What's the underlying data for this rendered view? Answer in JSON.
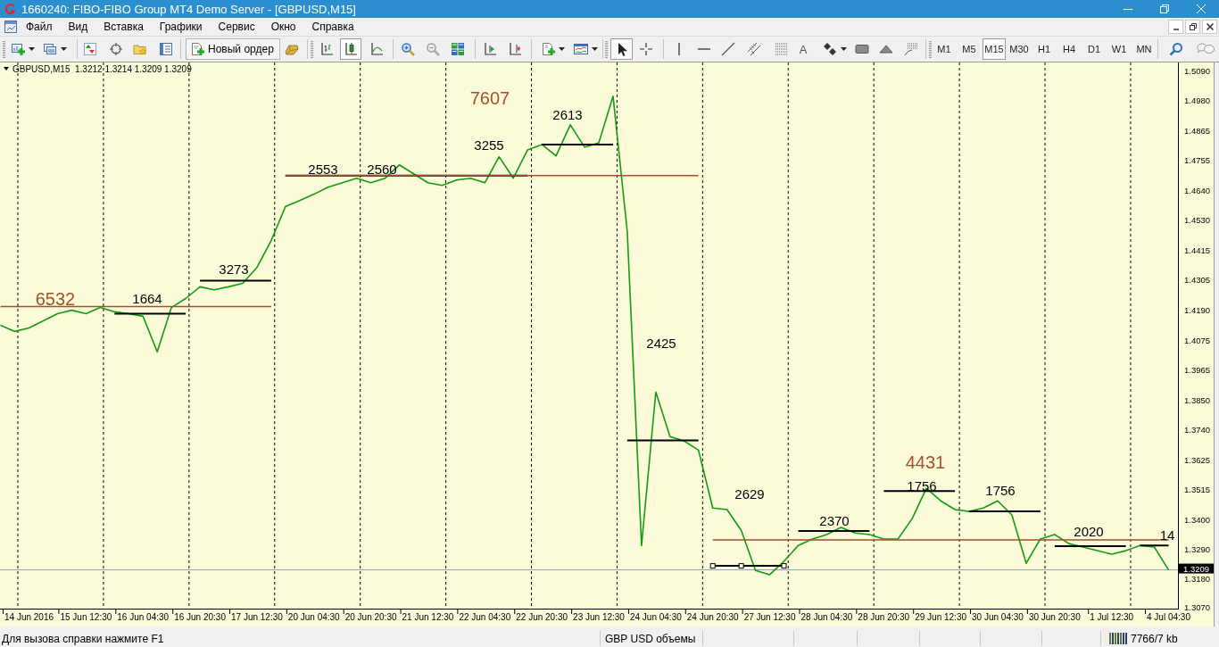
{
  "window": {
    "title": "1660240: FIBO-FIBO Group MT4 Demo Server - [GBPUSD,M15]"
  },
  "menu": [
    "Файл",
    "Вид",
    "Вставка",
    "Графики",
    "Сервис",
    "Окно",
    "Справка"
  ],
  "toolbar": {
    "new_order": "Новый ордер",
    "chart_types": [
      {
        "selected": false
      },
      {
        "selected": true
      },
      {
        "selected": false
      }
    ],
    "pointer_tools": [
      {
        "selected": true
      },
      {
        "selected": false
      }
    ],
    "text_tool": "A",
    "timeframes": [
      {
        "label": "M1",
        "selected": false
      },
      {
        "label": "M5",
        "selected": false
      },
      {
        "label": "M15",
        "selected": true
      },
      {
        "label": "M30",
        "selected": false
      },
      {
        "label": "H1",
        "selected": false
      },
      {
        "label": "H4",
        "selected": false
      },
      {
        "label": "D1",
        "selected": false
      },
      {
        "label": "W1",
        "selected": false
      },
      {
        "label": "MN",
        "selected": false
      }
    ]
  },
  "chart": {
    "chart_data": {
      "type": "line",
      "title": "GBPUSD,M15  1.3212 1.3214 1.3209 1.3209",
      "categories": [
        null,
        null,
        "14 Jun 2016",
        null,
        null,
        null,
        "15 Jun 12:30",
        null,
        null,
        null,
        "16 Jun 04:30",
        null,
        null,
        null,
        "16 Jun 20:30",
        null,
        null,
        null,
        "17 Jun 12:30",
        null,
        null,
        null,
        "20 Jun 04:30",
        null,
        null,
        null,
        "20 Jun 20:30",
        null,
        null,
        null,
        "21 Jun 12:30",
        null,
        null,
        null,
        "22 Jun 04:30",
        null,
        null,
        null,
        "22 Jun 20:30",
        null,
        null,
        null,
        "23 Jun 12:30",
        null,
        null,
        null,
        "24 Jun 04:30",
        null,
        null,
        null,
        "24 Jun 20:30",
        null,
        null,
        null,
        "27 Jun 12:30",
        null,
        null,
        null,
        "28 Jun 04:30",
        null,
        null,
        null,
        "28 Jun 20:30",
        null,
        null,
        null,
        "29 Jun 12:30",
        null,
        null,
        null,
        "30 Jun 04:30",
        null,
        null,
        null,
        "30 Jun 20:30",
        null,
        null,
        null,
        "1 Jul 12:30",
        null,
        null,
        null,
        "4 Jul 04:30"
      ],
      "series": [
        {
          "color": "#139a13",
          "values": [
            1.413,
            1.4107,
            1.412,
            1.4147,
            1.4174,
            1.4187,
            1.4174,
            1.4197,
            1.4181,
            1.4174,
            1.4164,
            1.403,
            1.4197,
            1.4231,
            1.4275,
            1.4264,
            1.4275,
            1.4288,
            1.4348,
            1.4449,
            1.4577,
            1.46,
            1.4624,
            1.465,
            1.4667,
            1.4684,
            1.4667,
            1.4684,
            1.4734,
            1.4701,
            1.4667,
            1.4657,
            1.4677,
            1.4684,
            1.4667,
            1.4765,
            1.4684,
            1.4791,
            1.4811,
            1.4768,
            1.4885,
            1.4801,
            1.4818,
            1.4993,
            1.4483,
            1.33,
            1.3879,
            1.3711,
            1.3694,
            1.366,
            1.3442,
            1.3436,
            1.3358,
            1.3207,
            1.3191,
            1.3241,
            1.3301,
            1.3325,
            1.3342,
            1.3369,
            1.3348,
            1.3342,
            1.3325,
            1.3325,
            1.3402,
            1.3516,
            1.3469,
            1.3436,
            1.3429,
            1.3442,
            1.3469,
            1.3416,
            1.3234,
            1.3325,
            1.3342,
            1.3308,
            1.3295,
            1.3281,
            1.3268,
            1.3281,
            1.3301,
            1.3295,
            1.3209
          ]
        },
        {
          "color": "#000000",
          "values": [
            null,
            null,
            null,
            null,
            null,
            null,
            null,
            null,
            1.4174,
            1.4174,
            1.4174,
            1.4174,
            1.4174,
            1.4174,
            1.4298,
            1.4298,
            1.4298,
            1.4298,
            1.4298,
            1.4298,
            1.4694,
            1.4694,
            1.4694,
            1.4694,
            1.4694,
            1.4694,
            1.4694,
            1.4694,
            1.4694,
            1.4694,
            1.4694,
            1.4694,
            1.4694,
            1.4694,
            1.4694,
            1.4694,
            1.4694,
            1.4694,
            1.4811,
            1.4811,
            1.4811,
            1.4811,
            1.4811,
            1.4811,
            1.3697,
            1.3697,
            1.3697,
            1.3697,
            1.3697,
            1.3697,
            null,
            null,
            null,
            null,
            null,
            null,
            1.3355,
            1.3355,
            1.3355,
            1.3355,
            1.3355,
            1.3355,
            1.3506,
            1.3506,
            1.3506,
            1.3506,
            1.3506,
            1.3506,
            1.3429,
            1.3429,
            1.3429,
            1.3429,
            1.3429,
            1.3429,
            1.3298,
            1.3298,
            1.3298,
            1.3298,
            1.3298,
            1.3298,
            1.3301,
            1.3301,
            1.3301
          ]
        },
        {
          "color": "#a0522d",
          "values": [
            1.4201,
            1.4201,
            1.4201,
            1.4201,
            1.4201,
            1.4201,
            1.4201,
            1.4201,
            1.4201,
            1.4201,
            1.4201,
            1.4201,
            1.4201,
            1.4201,
            1.4201,
            1.4201,
            1.4201,
            1.4201,
            1.4201,
            1.4201,
            1.4694,
            1.4694,
            1.4694,
            1.4694,
            1.4694,
            1.4694,
            1.4694,
            1.4694,
            1.4694,
            1.4694,
            1.4694,
            1.4694,
            1.4694,
            1.4694,
            1.4694,
            1.4694,
            1.4694,
            1.4694,
            1.4694,
            1.4694,
            1.4694,
            1.4694,
            1.4694,
            1.4694,
            1.4694,
            1.4694,
            1.4694,
            1.4694,
            1.4694,
            1.4694,
            1.3322,
            1.3322,
            1.3322,
            1.3322,
            1.3322,
            1.3322,
            1.3322,
            1.3322,
            1.3322,
            1.3322,
            1.3322,
            1.3322,
            1.3322,
            1.3322,
            1.3322,
            1.3322,
            1.3322,
            1.3322,
            1.3322,
            1.3322,
            1.3322,
            1.3322,
            1.3322,
            1.3322,
            1.3322,
            1.3322,
            1.3322,
            1.3322,
            1.3322,
            1.3322,
            1.3322,
            1.3322,
            1.3322
          ]
        },
        {
          "color": "#000000",
          "values": [
            null,
            null,
            null,
            null,
            null,
            null,
            null,
            null,
            null,
            null,
            null,
            null,
            null,
            null,
            null,
            null,
            null,
            null,
            null,
            null,
            null,
            null,
            null,
            null,
            null,
            null,
            null,
            null,
            null,
            null,
            null,
            null,
            null,
            null,
            null,
            null,
            null,
            null,
            null,
            null,
            null,
            null,
            null,
            null,
            null,
            null,
            null,
            null,
            null,
            null,
            1.3224,
            1.3224,
            1.3224,
            1.3224,
            1.3224,
            1.3224,
            null,
            null,
            null,
            null,
            null,
            null,
            null,
            null,
            null,
            null,
            null,
            null,
            null,
            null,
            null,
            null,
            null,
            null,
            null,
            null,
            null,
            null,
            null,
            null,
            null,
            null,
            null
          ]
        }
      ],
      "ylim": [
        1.3063,
        1.512
      ],
      "yticks": [
        {
          "value": 1.509,
          "label": "1.5090"
        },
        {
          "value": 1.498,
          "label": "1.4980"
        },
        {
          "value": 1.4865,
          "label": "1.4865"
        },
        {
          "value": 1.4755,
          "label": "1.4755"
        },
        {
          "value": 1.464,
          "label": "1.4640"
        },
        {
          "value": 1.453,
          "label": "1.4530"
        },
        {
          "value": 1.4415,
          "label": "1.4415"
        },
        {
          "value": 1.4305,
          "label": "1.4305"
        },
        {
          "value": 1.419,
          "label": "1.4190"
        },
        {
          "value": 1.4075,
          "label": "1.4075"
        },
        {
          "value": 1.3965,
          "label": "1.3965"
        },
        {
          "value": 1.385,
          "label": "1.3850"
        },
        {
          "value": 1.374,
          "label": "1.3740"
        },
        {
          "value": 1.3625,
          "label": "1.3625"
        },
        {
          "value": 1.3515,
          "label": "1.3515"
        },
        {
          "value": 1.34,
          "label": "1.3400"
        },
        {
          "value": 1.329,
          "label": "1.3290"
        },
        {
          "value": 1.318,
          "label": "1.3180"
        },
        {
          "value": 1.307,
          "label": "1.3070"
        }
      ],
      "ref_lines": [
        {
          "axis": "y",
          "value": 1.3209,
          "label": "1.3209",
          "color": "#8fa0bd"
        }
      ],
      "annotations": [
        "6532",
        "1664",
        "3273",
        "2553",
        "2560",
        "7607",
        "3255",
        "2613",
        "2425",
        "2629",
        "2370",
        "4431",
        "1756",
        "1756",
        "2020",
        "14"
      ]
    }
  },
  "status_bar": {
    "help": "Для вызова справки нажмите F1",
    "profile": "GBP USD объемы",
    "traffic": "7766/7 kb"
  }
}
